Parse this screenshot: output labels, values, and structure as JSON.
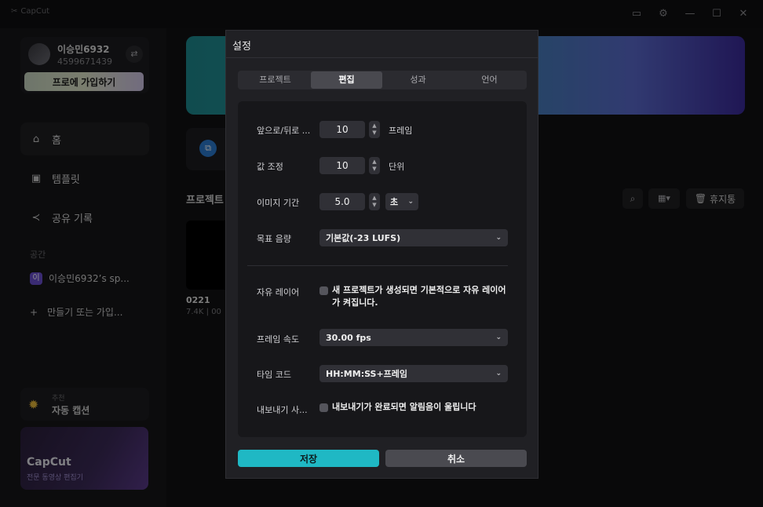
{
  "app": {
    "brand": "CapCut"
  },
  "profile": {
    "name": "이승민6932",
    "id": "4599671439",
    "pro_button": "프로에 가입하기"
  },
  "nav": {
    "home": "홈",
    "templates": "템플릿",
    "shared": "공유 기록"
  },
  "space": {
    "label": "공간",
    "badge": "이",
    "workspace": "이승민6932’s sp...",
    "create": "만들기 또는 가입..."
  },
  "promo": {
    "tag": "추천",
    "title": "자동 캡션"
  },
  "capcut_card": {
    "name": "CapCut",
    "subtitle": "전문 동영상 편집기"
  },
  "main": {
    "projects_title": "프로젝트",
    "trash_label": "휴지통",
    "project": {
      "name": "0221",
      "meta": "7.4K | 00"
    }
  },
  "dialog": {
    "title": "설정",
    "tabs": [
      {
        "label": "프로젝트"
      },
      {
        "label": "편집"
      },
      {
        "label": "성과"
      },
      {
        "label": "언어"
      }
    ],
    "rows": {
      "step": {
        "label": "앞으로/뒤로 ...",
        "value": "10",
        "unit": "프레임"
      },
      "adjust": {
        "label": "값 조정",
        "value": "10",
        "unit": "단위"
      },
      "image_duration": {
        "label": "이미지 기간",
        "value": "5.0",
        "unit_select": "초"
      },
      "loudness": {
        "label": "목표 음량",
        "value": "기본값(-23 LUFS)"
      },
      "free_layer": {
        "label": "자유 레이어",
        "text": "새 프로젝트가 생성되면 기본적으로 자유 레이어가 켜집니다."
      },
      "frame_rate": {
        "label": "프레임 속도",
        "value": "30.00 fps"
      },
      "timecode": {
        "label": "타임 코드",
        "value": "HH:MM:SS+프레임"
      },
      "export_sound": {
        "label": "내보내기 사...",
        "text": "내보내기가 완료되면 알림음이 울립니다"
      }
    },
    "save": "저장",
    "cancel": "취소"
  },
  "colors": {
    "accent": "#1fb8c4",
    "background": "#111113",
    "dialog": "#202024"
  }
}
